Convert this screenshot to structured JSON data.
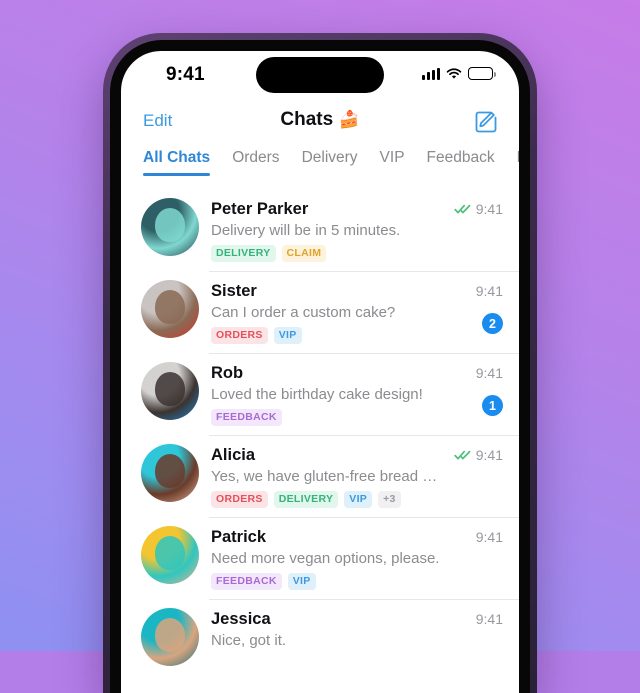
{
  "theme": {
    "bg_gradient_from": "#c77ce8",
    "bg_gradient_to": "#8e90f2",
    "accent_blue": "#2f86d8",
    "badge_blue": "#1a8cf0",
    "check_green": "#4cc07a"
  },
  "status_bar": {
    "time": "9:41",
    "cellular_icon": "signal-bars-icon",
    "wifi_icon": "wifi-icon",
    "battery_icon": "battery-icon"
  },
  "nav": {
    "edit_label": "Edit",
    "title": "Chats",
    "title_emoji": "🍰",
    "compose_icon": "compose-icon"
  },
  "tabs": [
    {
      "label": "All Chats",
      "active": true
    },
    {
      "label": "Orders",
      "active": false
    },
    {
      "label": "Delivery",
      "active": false
    },
    {
      "label": "VIP",
      "active": false
    },
    {
      "label": "Feedback",
      "active": false
    },
    {
      "label": "E",
      "active": false
    }
  ],
  "chats": [
    {
      "name": "Peter Parker",
      "preview": "Delivery will be in 5 minutes.",
      "time": "9:41",
      "read_receipt": true,
      "badge": null,
      "tags": [
        {
          "label": "DELIVERY",
          "style": "delivery"
        },
        {
          "label": "CLAIM",
          "style": "claim"
        }
      ],
      "avatar": {
        "name": "avatar-peter-parker",
        "c1": "#2e5f66",
        "c2": "#7fd8cf",
        "c3": "#1c3b49"
      }
    },
    {
      "name": "Sister",
      "preview": "Can I order a custom cake?",
      "time": "9:41",
      "read_receipt": false,
      "badge": "2",
      "tags": [
        {
          "label": "ORDERS",
          "style": "orders"
        },
        {
          "label": "VIP",
          "style": "vip"
        }
      ],
      "avatar": {
        "name": "avatar-sister",
        "c1": "#c9c4c2",
        "c2": "#8a6a55",
        "c3": "#d8322c"
      }
    },
    {
      "name": "Rob",
      "preview": "Loved the birthday cake design!",
      "time": "9:41",
      "read_receipt": false,
      "badge": "1",
      "tags": [
        {
          "label": "FEEDBACK",
          "style": "feedback"
        }
      ],
      "avatar": {
        "name": "avatar-rob",
        "c1": "#d4d2d0",
        "c2": "#3b3330",
        "c3": "#1e8ad6"
      }
    },
    {
      "name": "Alicia",
      "preview": "Yes, we have gluten-free bread available!",
      "time": "9:41",
      "read_receipt": true,
      "badge": null,
      "tags": [
        {
          "label": "ORDERS",
          "style": "orders"
        },
        {
          "label": "DELIVERY",
          "style": "delivery"
        },
        {
          "label": "VIP",
          "style": "vip"
        },
        {
          "label": "+3",
          "style": "more"
        }
      ],
      "avatar": {
        "name": "avatar-alicia",
        "c1": "#2ec6d8",
        "c2": "#6b3a2a",
        "c3": "#e0b59a"
      }
    },
    {
      "name": "Patrick",
      "preview": "Need more vegan options, please.",
      "time": "9:41",
      "read_receipt": false,
      "badge": null,
      "tags": [
        {
          "label": "FEEDBACK",
          "style": "feedback"
        },
        {
          "label": "VIP",
          "style": "vip"
        }
      ],
      "avatar": {
        "name": "avatar-patrick",
        "c1": "#f2c531",
        "c2": "#2fc6c0",
        "c3": "#e8b48c"
      }
    },
    {
      "name": "Jessica",
      "preview": "Nice, got it.",
      "time": "9:41",
      "read_receipt": false,
      "badge": null,
      "tags": [],
      "avatar": {
        "name": "avatar-jessica",
        "c1": "#1ab6c4",
        "c2": "#d9a57f",
        "c3": "#1f6f7a"
      }
    }
  ]
}
